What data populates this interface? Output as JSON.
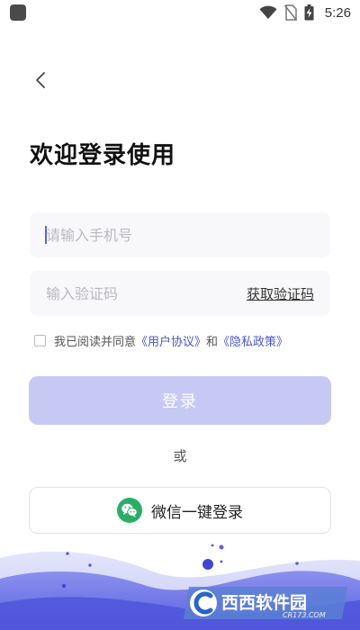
{
  "status_bar": {
    "time": "5:26"
  },
  "header": {
    "back_icon": "chevron-left-icon"
  },
  "title": "欢迎登录使用",
  "phone_input": {
    "placeholder": "请输入手机号",
    "value": ""
  },
  "code_input": {
    "placeholder": "输入验证码",
    "value": ""
  },
  "get_code_label": "获取验证码",
  "agreement": {
    "checked": false,
    "prefix": "我已阅读并同意",
    "user_agreement": "《用户协议》",
    "and": "和",
    "privacy_policy": "《隐私政策》"
  },
  "login_button_label": "登录",
  "or_label": "或",
  "wechat_login": {
    "label": "微信一键登录",
    "icon": "wechat-icon"
  },
  "watermark": {
    "brand": "西西软件园",
    "url": "CR173.COM"
  },
  "colors": {
    "accent": "#4c56c8",
    "login_button": "#c7c9f5",
    "input_bg": "#f8f8fa",
    "wechat_green": "#2aae67",
    "wave": "#6b72e6"
  }
}
